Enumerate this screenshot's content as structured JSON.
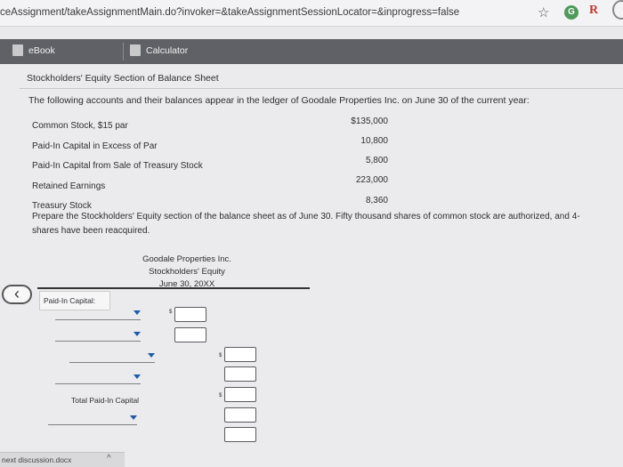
{
  "browser": {
    "url": "ceAssignment/takeAssignmentMain.do?invoker=&takeAssignmentSessionLocator=&inprogress=false",
    "star_icon": "star-icon",
    "extension_g": "G",
    "extension_r": "R"
  },
  "toolbar": {
    "ebook_label": "eBook",
    "calculator_label": "Calculator"
  },
  "problem": {
    "title": "Stockholders' Equity Section of Balance Sheet",
    "intro": "The following accounts and their balances appear in the ledger of Goodale Properties Inc. on June 30 of the current year:",
    "accounts": [
      {
        "name": "Common Stock, $15 par",
        "value": "$135,000"
      },
      {
        "name": "Paid-In Capital in Excess of Par",
        "value": "10,800"
      },
      {
        "name": "Paid-In Capital from Sale of Treasury Stock",
        "value": "5,800"
      },
      {
        "name": "Retained Earnings",
        "value": "223,000"
      },
      {
        "name": "Treasury Stock",
        "value": "8,360"
      }
    ],
    "prepare": "Prepare the Stockholders' Equity section of the balance sheet as of June 30. Fifty thousand shares of common stock are authorized, and 4-",
    "prepare_line2": "shares have been reacquired."
  },
  "statement": {
    "company": "Goodale Properties Inc.",
    "name": "Stockholders' Equity",
    "date": "June 30, 20XX",
    "paid_in_label": "Paid-In Capital:",
    "total_paid_in_label": "Total Paid-In Capital",
    "dollar_sign": "$"
  },
  "downloads": {
    "file": "next discussion.docx"
  }
}
